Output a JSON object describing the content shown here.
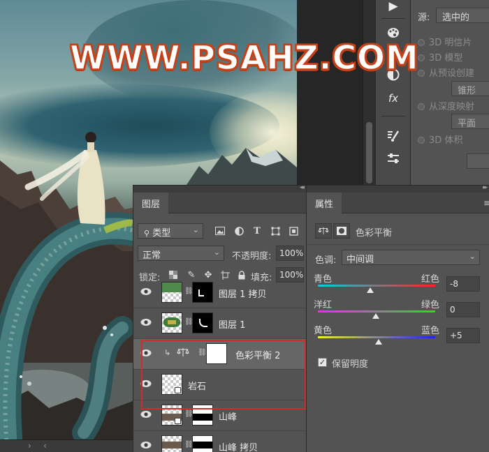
{
  "watermark": "WWW.PSAHZ.COM",
  "canvas": {
    "nav_right": "›",
    "nav_left": "‹"
  },
  "source_panel": {
    "source_label": "源:",
    "source_value": "选中的",
    "options": [
      {
        "label": "3D 明信片"
      },
      {
        "label": "3D 模型"
      },
      {
        "label": "从预设创建"
      },
      {
        "label": "锥形"
      },
      {
        "label": "从深度映射"
      },
      {
        "label": "平面"
      },
      {
        "label": "3D 体积"
      }
    ]
  },
  "layers_panel": {
    "tab": "图层",
    "filter_kind": "类型",
    "blend_mode": "正常",
    "opacity_label": "不透明度:",
    "opacity_value": "100%",
    "lock_label": "锁定:",
    "fill_label": "填充:",
    "fill_value": "100%",
    "layers": [
      {
        "name": "图层 1 拷贝",
        "selected": false
      },
      {
        "name": "图层 1",
        "selected": false
      },
      {
        "name": "色彩平衡 2",
        "selected": true
      },
      {
        "name": "岩石",
        "selected": false
      },
      {
        "name": "山峰",
        "selected": false
      },
      {
        "name": "山峰 拷贝",
        "selected": false
      }
    ]
  },
  "properties_panel": {
    "tab": "属性",
    "adjustment_title": "色彩平衡",
    "tone_label": "色调:",
    "tone_value": "中间调",
    "sliders": [
      {
        "left": "青色",
        "right": "红色",
        "value": "-8",
        "position_fraction": 0.46
      },
      {
        "left": "洋红",
        "right": "绿色",
        "value": "0",
        "position_fraction": 0.5
      },
      {
        "left": "黄色",
        "right": "蓝色",
        "value": "+5",
        "position_fraction": 0.525
      }
    ],
    "preserve_luminosity": "保留明度",
    "preserve_checked": true
  },
  "colors": {
    "panel_bg": "#535353",
    "selection_outline": "#d12b2b",
    "watermark_stroke": "#c4421a"
  }
}
